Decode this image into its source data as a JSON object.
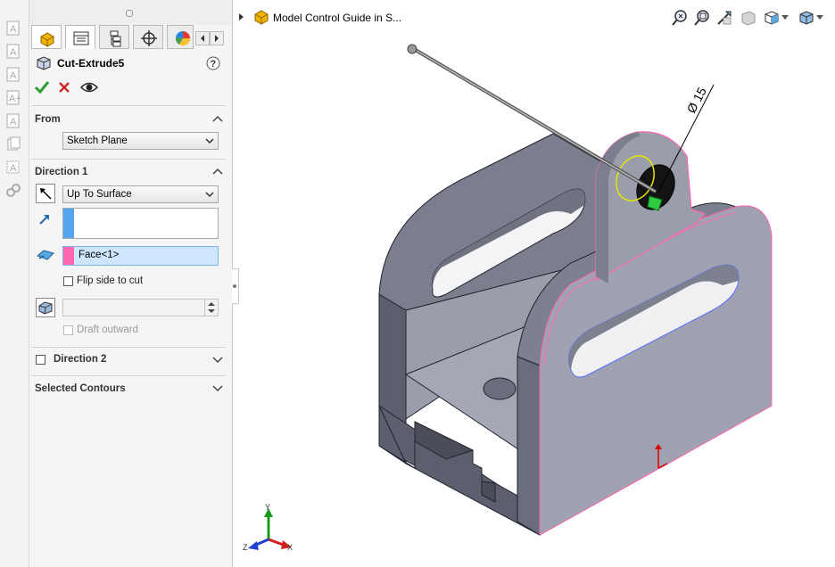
{
  "feature": {
    "title": "Cut-Extrude5",
    "ok_icon": "checkmark-icon",
    "cancel_icon": "close-icon",
    "preview_icon": "eye-icon",
    "help_icon": "help-icon"
  },
  "from": {
    "header": "From",
    "value": "Sketch Plane"
  },
  "direction1": {
    "header": "Direction 1",
    "end_condition": "Up To Surface",
    "surface_value": "Face<1>",
    "flip_side_label": "Flip side to cut",
    "draft_outward_label": "Draft outward"
  },
  "direction2": {
    "header": "Direction 2"
  },
  "selected_contours": {
    "header": "Selected Contours"
  },
  "tree": {
    "title": "Model Control Guide in S..."
  },
  "dimension": {
    "text": "Ø 15"
  },
  "triad": {
    "x": "X",
    "y": "Y",
    "z": "Z"
  },
  "colors": {
    "accept": "#2e9e2e",
    "cancel": "#cc2a2a",
    "selection_pink": "#ff69b4",
    "selection_blue": "#55a6f0",
    "model_face": "#8c8f9e",
    "selected_field": "#cde6fb"
  }
}
